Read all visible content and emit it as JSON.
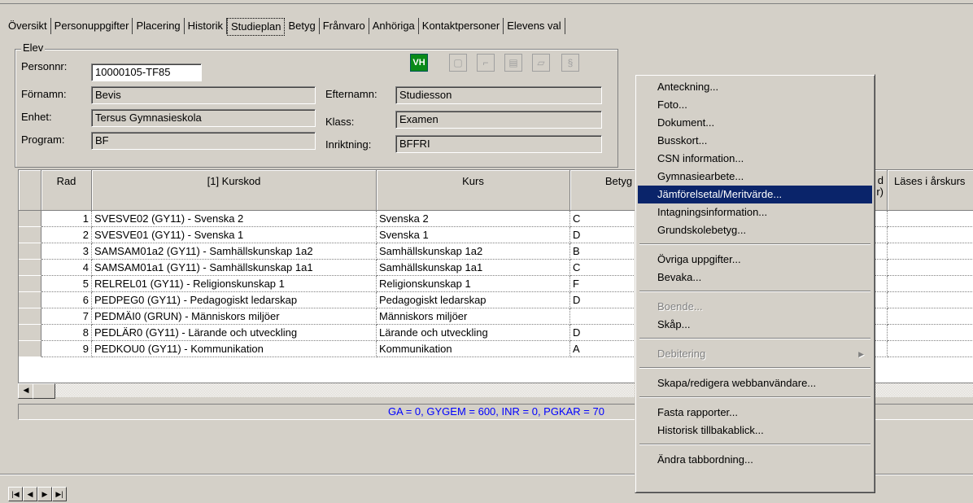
{
  "tabs": [
    "Översikt",
    "Personuppgifter",
    "Placering",
    "Historik",
    "Studieplan",
    "Betyg",
    "Frånvaro",
    "Anhöriga",
    "Kontaktpersoner",
    "Elevens val"
  ],
  "active_tab": "Studieplan",
  "elev": {
    "legend": "Elev",
    "personnr_label": "Personnr:",
    "personnr_value": "10000105-TF85",
    "fornamn_label": "Förnamn:",
    "fornamn_value": "Bevis",
    "enhet_label": "Enhet:",
    "enhet_value": "Tersus Gymnasieskola",
    "program_label": "Program:",
    "program_value": "BF",
    "efternamn_label": "Efternamn:",
    "efternamn_value": "Studiesson",
    "klass_label": "Klass:",
    "klass_value": "Examen",
    "inriktning_label": "Inriktning:",
    "inriktning_value": "BFFRI",
    "vh_badge": "VH"
  },
  "grid": {
    "columns": [
      "Rad",
      "[1] Kurskod",
      "Kurs",
      "Betyg",
      "d\nr)",
      "Läses i årskurs"
    ],
    "rows": [
      {
        "rad": "1",
        "kurskod": "SVESVE02 (GY11) - Svenska 2",
        "kurs": "Svenska 2",
        "betyg": "C"
      },
      {
        "rad": "2",
        "kurskod": "SVESVE01 (GY11) - Svenska 1",
        "kurs": "Svenska 1",
        "betyg": "D"
      },
      {
        "rad": "3",
        "kurskod": "SAMSAM01a2 (GY11) - Samhällskunskap 1a2",
        "kurs": "Samhällskunskap 1a2",
        "betyg": "B"
      },
      {
        "rad": "4",
        "kurskod": "SAMSAM01a1 (GY11) - Samhällskunskap 1a1",
        "kurs": "Samhällskunskap 1a1",
        "betyg": "C"
      },
      {
        "rad": "5",
        "kurskod": "RELREL01 (GY11) - Religionskunskap 1",
        "kurs": "Religionskunskap 1",
        "betyg": "F"
      },
      {
        "rad": "6",
        "kurskod": "PEDPEG0 (GY11) - Pedagogiskt ledarskap",
        "kurs": "Pedagogiskt ledarskap",
        "betyg": "D"
      },
      {
        "rad": "7",
        "kurskod": "PEDMÄI0 (GRUN) - Människors miljöer",
        "kurs": "Människors miljöer",
        "betyg": ""
      },
      {
        "rad": "8",
        "kurskod": "PEDLÄR0 (GY11) - Lärande och utveckling",
        "kurs": "Lärande och utveckling",
        "betyg": "D"
      },
      {
        "rad": "9",
        "kurskod": "PEDKOU0 (GY11) - Kommunikation",
        "kurs": "Kommunikation",
        "betyg": "A"
      }
    ]
  },
  "status_text": "GA = 0, GYGEM = 600, INR = 0, PGKAR = 70",
  "context_menu": {
    "items": [
      {
        "label": "Anteckning...",
        "state": "normal"
      },
      {
        "label": "Foto...",
        "state": "normal"
      },
      {
        "label": "Dokument...",
        "state": "normal"
      },
      {
        "label": "Busskort...",
        "state": "normal"
      },
      {
        "label": "CSN information...",
        "state": "normal"
      },
      {
        "label": "Gymnasiearbete...",
        "state": "normal"
      },
      {
        "label": "Jämförelsetal/Meritvärde...",
        "state": "highlighted"
      },
      {
        "label": "Intagningsinformation...",
        "state": "normal"
      },
      {
        "label": "Grundskolebetyg...",
        "state": "normal"
      },
      {
        "label": "Övriga uppgifter...",
        "state": "normal"
      },
      {
        "label": "Bevaka...",
        "state": "normal"
      },
      {
        "label": "Boende...",
        "state": "disabled"
      },
      {
        "label": "Skåp...",
        "state": "normal"
      },
      {
        "label": "Debitering",
        "state": "disabled"
      },
      {
        "label": "Skapa/redigera webbanvändare...",
        "state": "normal"
      },
      {
        "label": "Fasta rapporter...",
        "state": "normal"
      },
      {
        "label": "Historisk tillbakablick...",
        "state": "normal"
      },
      {
        "label": "Ändra tabbordning...",
        "state": "normal"
      }
    ]
  },
  "colors": {
    "highlight": "#0a246a",
    "status_text": "#0000ff",
    "window_bg": "#d4d0c8"
  }
}
